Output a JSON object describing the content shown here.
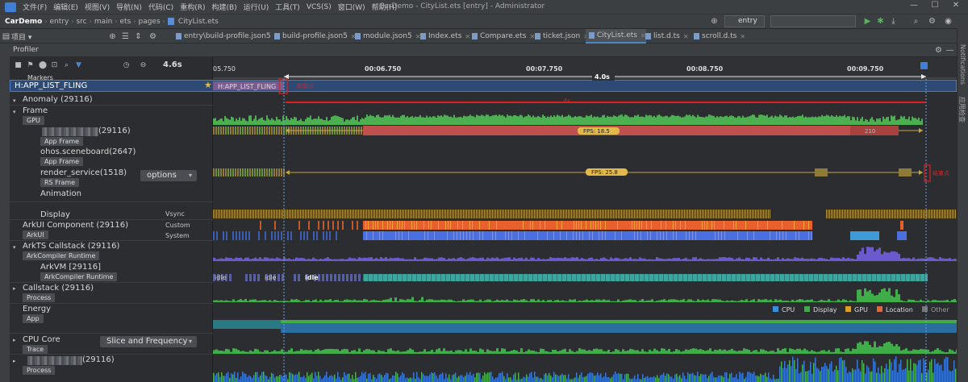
{
  "menubar": {
    "items": [
      "文件(F)",
      "编辑(E)",
      "视图(V)",
      "导航(N)",
      "代码(C)",
      "重构(R)",
      "构建(B)",
      "运行(U)",
      "工具(T)",
      "VCS(S)",
      "窗口(W)",
      "帮助(H)"
    ],
    "window_title": "CarDemo - CityList.ets [entry] - Administrator"
  },
  "breadcrumb": [
    "CarDemo",
    "entry",
    "src",
    "main",
    "ets",
    "pages",
    "CityList.ets"
  ],
  "toolbar": {
    "run_config": "entry"
  },
  "project_panel": {
    "label": "项目"
  },
  "tabs": [
    {
      "label": "entry\\build-profile.json5"
    },
    {
      "label": "build-profile.json5"
    },
    {
      "label": "module.json5"
    },
    {
      "label": "Index.ets"
    },
    {
      "label": "Compare.ets"
    },
    {
      "label": "ticket.json"
    },
    {
      "label": "CityList.ets",
      "active": true
    },
    {
      "label": "list.d.ts"
    },
    {
      "label": "scroll.d.ts"
    }
  ],
  "side_right": {
    "notifications": "Notifications",
    "other": "应用检查"
  },
  "profiler": {
    "title": "Profiler",
    "duration": "4.6s",
    "ruler": {
      "ticks": [
        "05.750",
        "00:06.750",
        "00:07.750",
        "00:08.750",
        "00:09.750"
      ],
      "selection": "4.0s"
    },
    "markers_label": "Markers",
    "marker_name": "H:APP_LIST_FLING",
    "marker_annotation_start": "起始点",
    "marker_annotation_end": "结束点",
    "lanes": {
      "anomaly": "Anomaly (29116)",
      "frame": "Frame",
      "frame_badge": "GPU",
      "app_proc": "(29116)",
      "app_frame_badge": "App Frame",
      "sceneboard": "ohos.sceneboard(2647)",
      "sceneboard_badge": "App Frame",
      "render": "render_service(1518)",
      "render_badge": "RS Frame",
      "render_dropdown": "options",
      "animation": "Animation",
      "display": "Display",
      "display_sub": "Vsync",
      "arkui": "ArkUI Component (29116)",
      "arkui_badge": "ArkUI",
      "arkui_custom": "Custom",
      "arkui_system": "System",
      "arkts": "ArkTS Callstack (29116)",
      "arkts_badge": "ArkCompiler Runtime",
      "arkvm": "ArkVM [29116]",
      "arkvm_badge": "ArkCompiler Runtime",
      "callstack": "Callstack (29116)",
      "callstack_badge": "Process",
      "energy": "Energy",
      "energy_badge": "App",
      "cpucore": "CPU Core",
      "cpucore_badge": "Trace",
      "cpucore_dropdown": "Slice and Frequency",
      "proc2": "(29116)",
      "proc2_badge": "Process"
    },
    "anomaly_duration": "4s",
    "fps_app": "FPS: 18.5",
    "fps_app_right": "210",
    "fps_render": "FPS: 25.8",
    "idle_labels": [
      "idle",
      "idle",
      "idle"
    ],
    "energy_legend": [
      "CPU",
      "Display",
      "GPU",
      "Location",
      "Other"
    ]
  },
  "colors": {
    "cpu": "#3b8ed8",
    "display": "#3fae49",
    "gpu": "#d9a12a",
    "location": "#e0693c",
    "other": "#777777",
    "frame_green": "#4caf50",
    "fps_red": "#c0504d",
    "arkui_orange": "#e8612c",
    "system_blue": "#4a6fe0",
    "callstack_purple": "#6a5acd",
    "arkvm_teal": "#3aa6a0",
    "red_marker": "#e02020"
  }
}
